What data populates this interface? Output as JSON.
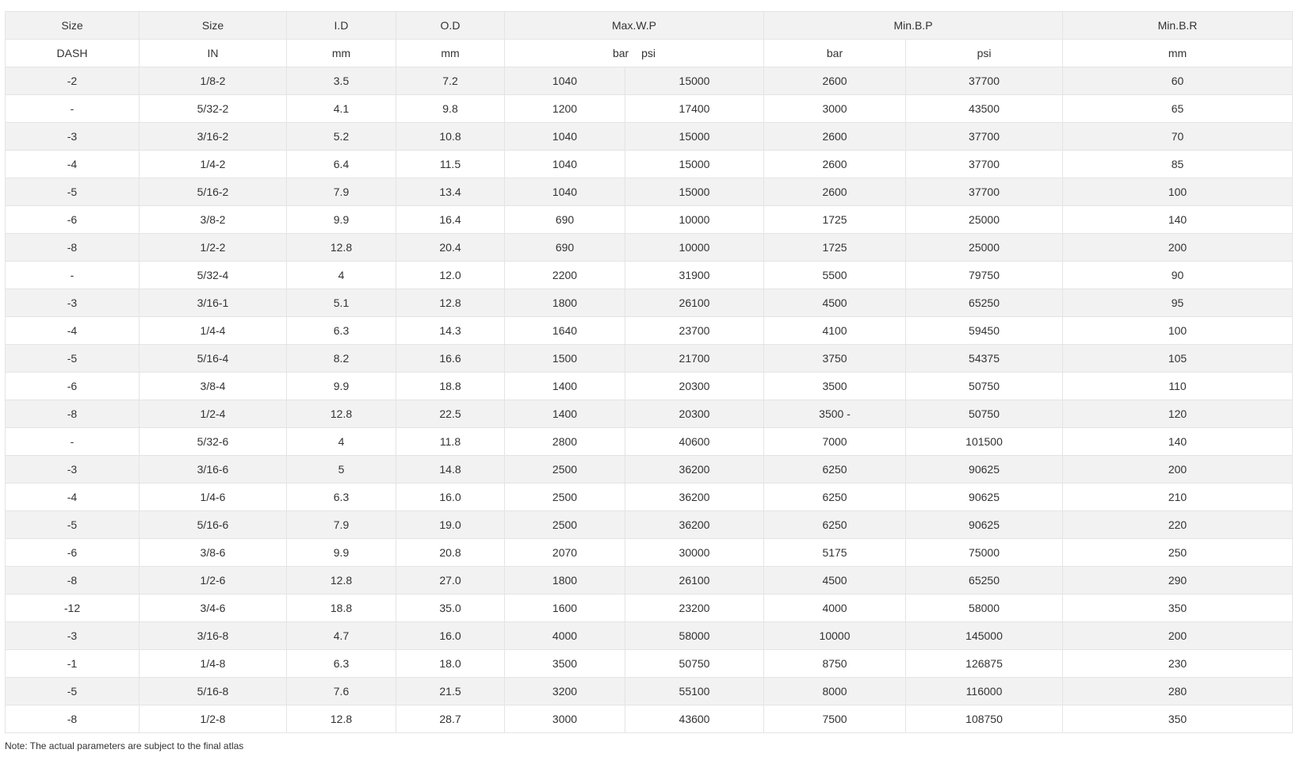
{
  "header": {
    "row1": {
      "size_dash": "Size",
      "size_in": "Size",
      "id": "I.D",
      "od": "O.D",
      "max_wp": "Max.W.P",
      "min_bp": "Min.B.P",
      "min_br": "Min.B.R"
    },
    "row2": {
      "size_dash": "DASH",
      "size_in": "IN",
      "id": "mm",
      "od": "mm",
      "max_wp_bar": "bar",
      "max_wp_psi": "psi",
      "min_bp_bar": "bar",
      "min_bp_psi": "psi",
      "min_br": "mm"
    }
  },
  "rows": [
    [
      "-2",
      "1/8-2",
      "3.5",
      "7.2",
      "1040",
      "15000",
      "2600",
      "37700",
      "60"
    ],
    [
      "-",
      "5/32-2",
      "4.1",
      "9.8",
      "1200",
      "17400",
      "3000",
      "43500",
      "65"
    ],
    [
      "-3",
      "3/16-2",
      "5.2",
      "10.8",
      "1040",
      "15000",
      "2600",
      "37700",
      "70"
    ],
    [
      "-4",
      "1/4-2",
      "6.4",
      "11.5",
      "1040",
      "15000",
      "2600",
      "37700",
      "85"
    ],
    [
      "-5",
      "5/16-2",
      "7.9",
      "13.4",
      "1040",
      "15000",
      "2600",
      "37700",
      "100"
    ],
    [
      "-6",
      "3/8-2",
      "9.9",
      "16.4",
      "690",
      "10000",
      "1725",
      "25000",
      "140"
    ],
    [
      "-8",
      "1/2-2",
      "12.8",
      "20.4",
      "690",
      "10000",
      "1725",
      "25000",
      "200"
    ],
    [
      "-",
      "5/32-4",
      "4",
      "12.0",
      "2200",
      "31900",
      "5500",
      "79750",
      "90"
    ],
    [
      "-3",
      "3/16-1",
      "5.1",
      "12.8",
      "1800",
      "26100",
      "4500",
      "65250",
      "95"
    ],
    [
      "-4",
      "1/4-4",
      "6.3",
      "14.3",
      "1640",
      "23700",
      "4100",
      "59450",
      "100"
    ],
    [
      "-5",
      "5/16-4",
      "8.2",
      "16.6",
      "1500",
      "21700",
      "3750",
      "54375",
      "105"
    ],
    [
      "-6",
      "3/8-4",
      "9.9",
      "18.8",
      "1400",
      "20300",
      "3500",
      "50750",
      "110"
    ],
    [
      "-8",
      "1/2-4",
      "12.8",
      "22.5",
      "1400",
      "20300",
      "3500 -",
      "50750",
      "120"
    ],
    [
      "-",
      "5/32-6",
      "4",
      "11.8",
      "2800",
      "40600",
      "7000",
      "101500",
      "140"
    ],
    [
      "-3",
      "3/16-6",
      "5",
      "14.8",
      "2500",
      "36200",
      "6250",
      "90625",
      "200"
    ],
    [
      "-4",
      "1/4-6",
      "6.3",
      "16.0",
      "2500",
      "36200",
      "6250",
      "90625",
      "210"
    ],
    [
      "-5",
      "5/16-6",
      "7.9",
      "19.0",
      "2500",
      "36200",
      "6250",
      "90625",
      "220"
    ],
    [
      "-6",
      "3/8-6",
      "9.9",
      "20.8",
      "2070",
      "30000",
      "5175",
      "75000",
      "250"
    ],
    [
      "-8",
      "1/2-6",
      "12.8",
      "27.0",
      "1800",
      "26100",
      "4500",
      "65250",
      "290"
    ],
    [
      "-12",
      "3/4-6",
      "18.8",
      "35.0",
      "1600",
      "23200",
      "4000",
      "58000",
      "350"
    ],
    [
      "-3",
      "3/16-8",
      "4.7",
      "16.0",
      "4000",
      "58000",
      "10000",
      "145000",
      "200"
    ],
    [
      "-1",
      "1/4-8",
      "6.3",
      "18.0",
      "3500",
      "50750",
      "8750",
      "126875",
      "230"
    ],
    [
      "-5",
      "5/16-8",
      "7.6",
      "21.5",
      "3200",
      "55100",
      "8000",
      "116000",
      "280"
    ],
    [
      "-8",
      "1/2-8",
      "12.8",
      "28.7",
      "3000",
      "43600",
      "7500",
      "108750",
      "350"
    ]
  ],
  "note": "Note: The actual parameters are subject to the final atlas"
}
